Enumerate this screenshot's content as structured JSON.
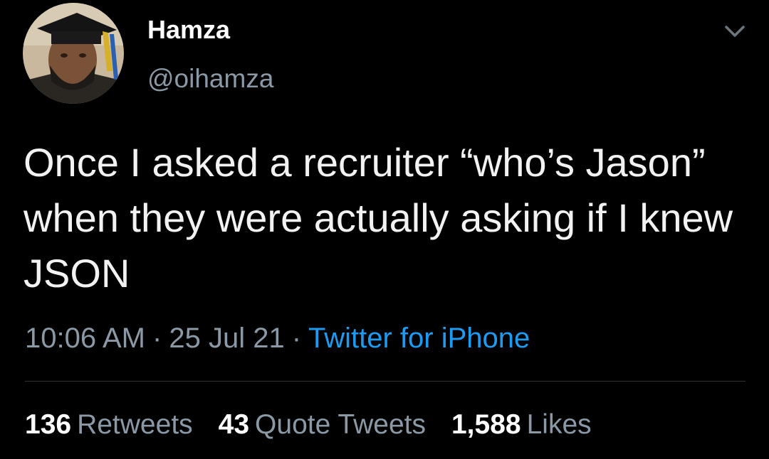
{
  "tweet": {
    "author": {
      "name": "Hamza",
      "handle": "@oihamza",
      "avatar_icon": "profile-photo-graduation-cap"
    },
    "menu_icon": "chevron-down-icon",
    "text": "Once I asked a recruiter “who’s Jason” when they were actually asking if I knew JSON",
    "time": "10:06 AM",
    "date": "25 Jul 21",
    "separator": "·",
    "source": "Twitter for iPhone",
    "stats": {
      "retweets": {
        "count": "136",
        "label": "Retweets"
      },
      "quotes": {
        "count": "43",
        "label": "Quote Tweets"
      },
      "likes": {
        "count": "1,588",
        "label": "Likes"
      }
    },
    "colors": {
      "background": "#000000",
      "link": "#1d9bf0",
      "secondary_text": "#8b98a5",
      "divider": "#2f3336"
    }
  }
}
